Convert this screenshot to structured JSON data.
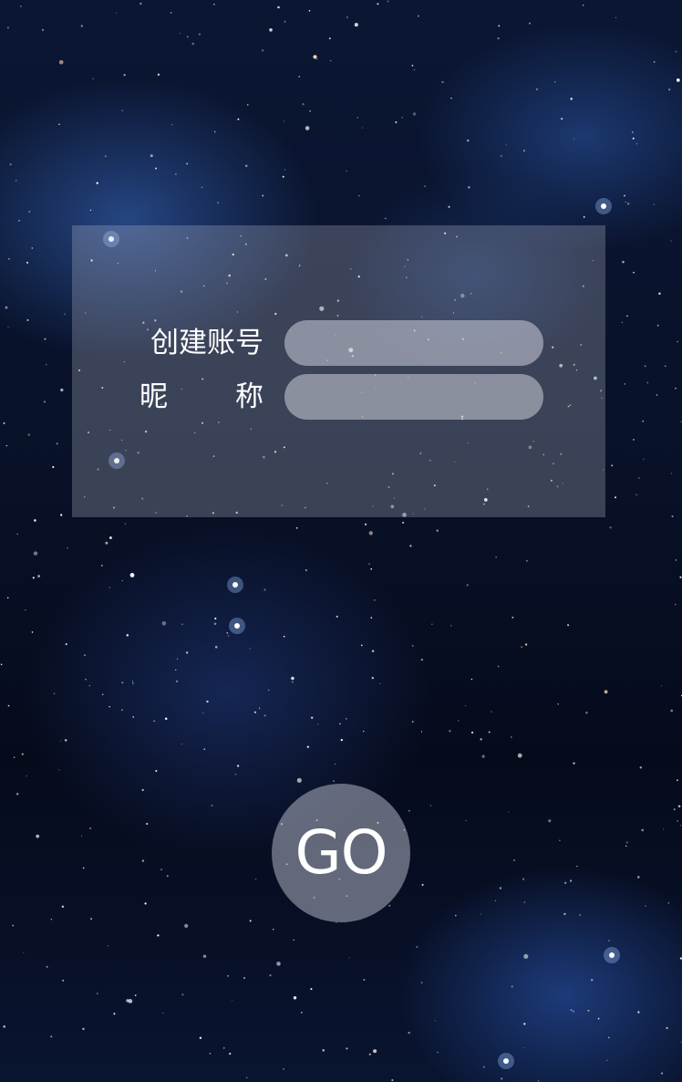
{
  "form": {
    "account": {
      "label": "创建账号",
      "value": "",
      "placeholder": ""
    },
    "nickname": {
      "label_first": "昵",
      "label_second": "称",
      "value": "",
      "placeholder": ""
    }
  },
  "go_button": {
    "label": "GO"
  },
  "theme": {
    "background": "#081128",
    "panel": "rgba(190,195,210,0.28)",
    "field": "rgba(205,208,218,0.55)",
    "text": "#ffffff"
  }
}
